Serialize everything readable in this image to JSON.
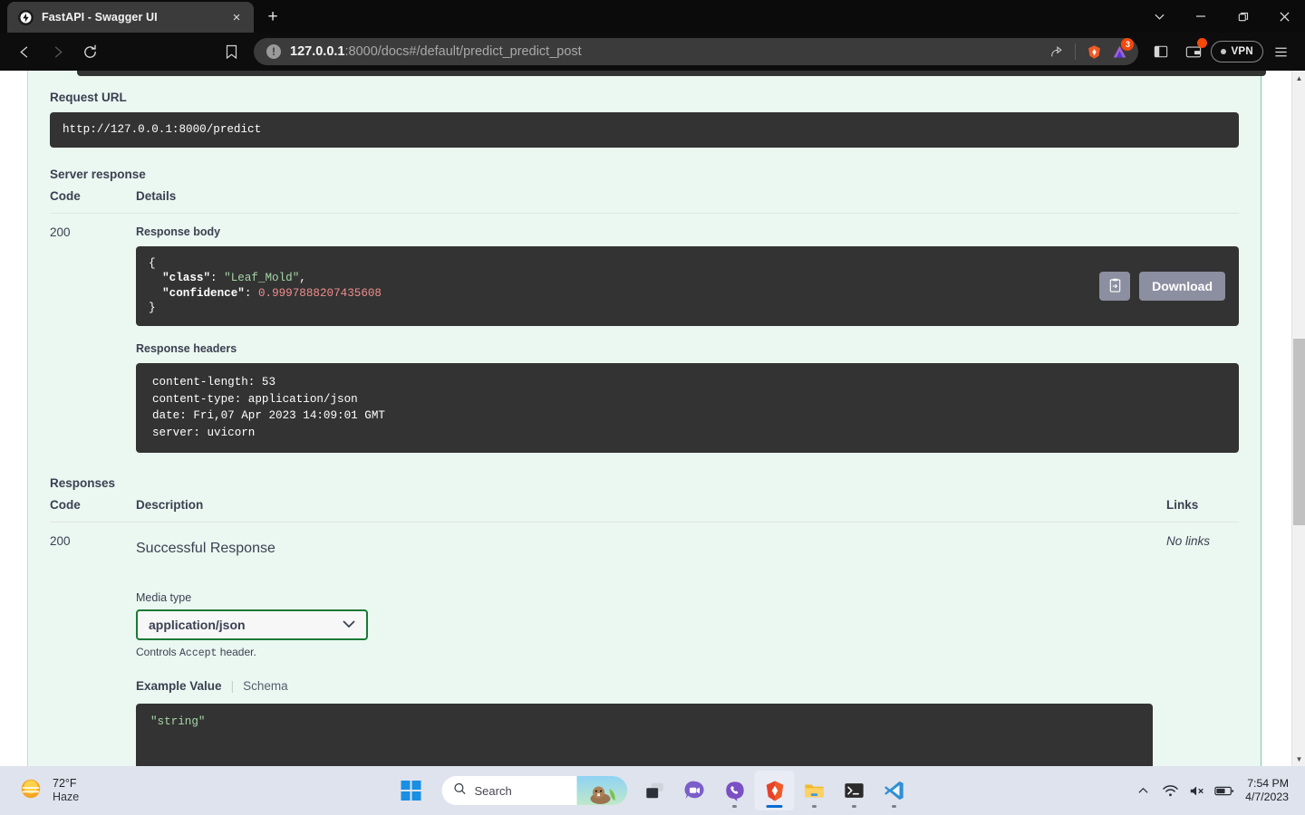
{
  "browser": {
    "tab": {
      "title": "FastAPI - Swagger UI",
      "favicon": "fastapi-icon",
      "close": "×"
    },
    "new_tab_label": "+",
    "window_controls": [
      {
        "name": "tab-search-button",
        "glyph": "⌄"
      },
      {
        "name": "minimize-button",
        "glyph": "–"
      },
      {
        "name": "maximize-button",
        "glyph": "❐"
      },
      {
        "name": "close-window-button",
        "glyph": "✕"
      }
    ],
    "nav": {
      "back": "back-arrow-icon",
      "forward": "forward-arrow-icon",
      "reload": "reload-icon",
      "bookmark": "bookmark-icon"
    },
    "omnibox": {
      "host": "127.0.0.1",
      "path": ":8000/docs#/default/predict_predict_post",
      "full_url": "127.0.0.1:8000/docs#/default/predict_predict_post",
      "info_glyph": "!"
    },
    "toolbar": {
      "share_icon": "share-icon",
      "brave_shields_icon": "brave-lion-icon",
      "extension_icon": "extension-icon",
      "extension_badge": "3",
      "sidebar_icon": "sidebar-panel-icon",
      "wallet_icon": "brave-wallet-icon",
      "wallet_badge": "",
      "vpn_label": "VPN",
      "menu_icon": "hamburger-menu-icon"
    }
  },
  "page": {
    "request_url": {
      "label": "Request URL",
      "value": "http://127.0.0.1:8000/predict"
    },
    "server_response": {
      "label": "Server response",
      "columns": {
        "code": "Code",
        "details": "Details"
      },
      "row": {
        "code": "200",
        "response_body_label": "Response body",
        "body_lines": [
          {
            "punc": "{"
          },
          {
            "key": "\"class\"",
            "sep": ": ",
            "str": "\"Leaf_Mold\"",
            "tail": ","
          },
          {
            "key": "\"confidence\"",
            "sep": ": ",
            "num": "0.9997888207435608"
          },
          {
            "punc": "}"
          }
        ],
        "copy_button": "copy-to-clipboard-icon",
        "download_button": "Download",
        "response_headers_label": "Response headers",
        "headers": "content-length: 53\ncontent-type: application/json\ndate: Fri,07 Apr 2023 14:09:01 GMT\nserver: uvicorn"
      }
    },
    "responses": {
      "label": "Responses",
      "columns": {
        "code": "Code",
        "description": "Description",
        "links": "Links"
      },
      "row": {
        "code": "200",
        "description": "Successful Response",
        "links": "No links",
        "media_type_label": "Media type",
        "media_type_value": "application/json",
        "media_type_chevron": "⌄",
        "controls_prefix": "Controls ",
        "controls_code": "Accept",
        "controls_suffix": " header.",
        "tab_example": "Example Value",
        "tab_schema": "Schema",
        "example_value": "\"string\""
      }
    },
    "colors": {
      "page_bg": "#ebf7f1",
      "dark_block": "#333333",
      "accent_green": "#1b7a36",
      "string_green": "#a5d6a7",
      "number_red": "#f08d8d",
      "button_gray": "#8c8fa0"
    }
  },
  "taskbar": {
    "weather": {
      "temperature": "72°F",
      "condition": "Haze",
      "icon": "haze-sun-icon"
    },
    "start_button": "windows-start-icon",
    "search": {
      "placeholder": "Search",
      "icon": "search-icon",
      "art": "beaver-illustration"
    },
    "apps": [
      {
        "name": "task-view-icon",
        "glyph": "taskview",
        "running": false
      },
      {
        "name": "chat-teams-icon",
        "glyph": "chat",
        "running": false
      },
      {
        "name": "viber-icon",
        "glyph": "viber",
        "running": true
      },
      {
        "name": "brave-browser-icon",
        "glyph": "brave",
        "running": true,
        "active": true
      },
      {
        "name": "file-explorer-icon",
        "glyph": "folder",
        "running": true
      },
      {
        "name": "terminal-icon",
        "glyph": "terminal",
        "running": true
      },
      {
        "name": "vscode-icon",
        "glyph": "vscode",
        "running": true
      }
    ],
    "tray": {
      "overflow": "show-hidden-icons-chevron",
      "wifi": "wifi-icon",
      "volume": "volume-muted-icon",
      "battery": "battery-icon",
      "time": "7:54 PM",
      "date": "4/7/2023"
    }
  }
}
